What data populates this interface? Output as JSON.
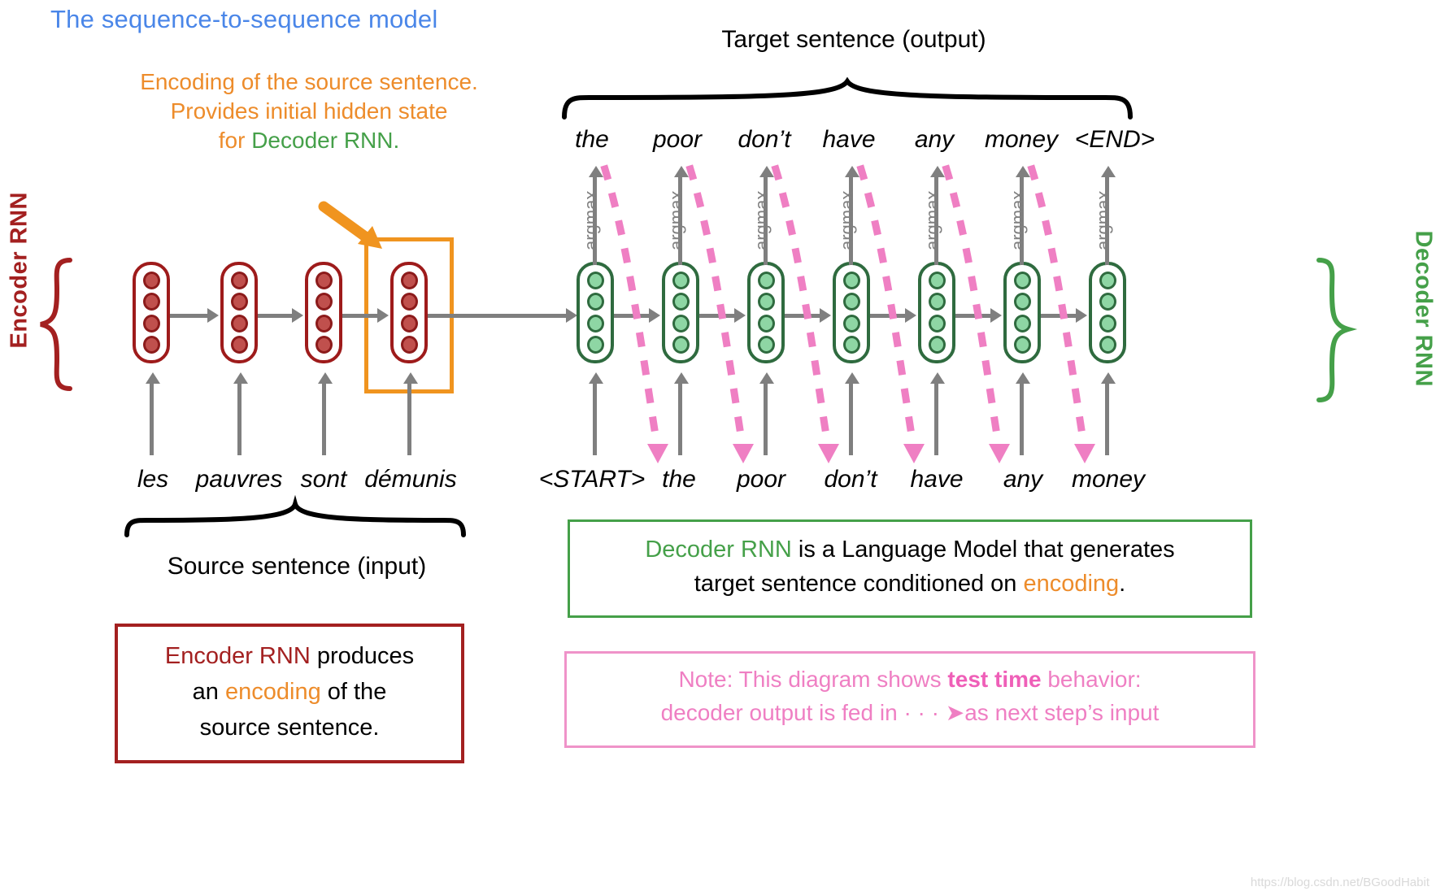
{
  "title": "The sequence-to-sequence model",
  "annotations": {
    "encoding_note_line1": "Encoding of the source sentence.",
    "encoding_note_line2": "Provides initial hidden state",
    "encoding_note_line3_prefix": "for ",
    "encoding_note_line3_green": "Decoder RNN."
  },
  "captions": {
    "target": "Target sentence (output)",
    "source": "Source sentence (input)"
  },
  "side_labels": {
    "encoder": "Encoder RNN",
    "decoder": "Decoder RNN"
  },
  "encoder": {
    "inputs": [
      "les",
      "pauvres",
      "sont",
      "démunis"
    ],
    "cell_count": 4,
    "units_per_cell": 4,
    "border_color": "#9e1b1b",
    "dot_color": "#c0504d"
  },
  "decoder": {
    "outputs": [
      "the",
      "poor",
      "don’t",
      "have",
      "any",
      "money",
      "<END>"
    ],
    "inputs": [
      "<START>",
      "the",
      "poor",
      "don’t",
      "have",
      "any",
      "money"
    ],
    "argmax_label": "argmax",
    "cell_count": 7,
    "units_per_cell": 4,
    "border_color": "#2f6b3f",
    "dot_color": "#8ed6a4"
  },
  "decoder_box": {
    "line1_green": "Decoder RNN",
    "line1_rest": " is a Language Model that generates",
    "line2_pre": "target sentence conditioned on ",
    "line2_orange": "encoding",
    "line2_post": ".",
    "border_color": "#45a049"
  },
  "note_box": {
    "line1_pre": "Note: This diagram shows ",
    "line1_bold": "test time",
    "line1_post": " behavior:",
    "line2_pre": "decoder output is fed in ",
    "line2_arrow": "· · · ➤",
    "line2_post": "as next step’s input",
    "border_color": "#ef93c9"
  },
  "encoder_box": {
    "line1_red": "Encoder RNN",
    "line1_rest": " produces",
    "line2_pre": "an ",
    "line2_orange": "encoding",
    "line2_post": " of the",
    "line3": "source sentence.",
    "border_color": "#a32020"
  },
  "colors": {
    "title_blue": "#4a86e8",
    "orange": "#ed8c2b",
    "green": "#45a049",
    "dark_red": "#a32020",
    "pink": "#ef7fc3",
    "grey_arrow": "#7f7f7f"
  },
  "watermark": "https://blog.csdn.net/BGoodHabit"
}
